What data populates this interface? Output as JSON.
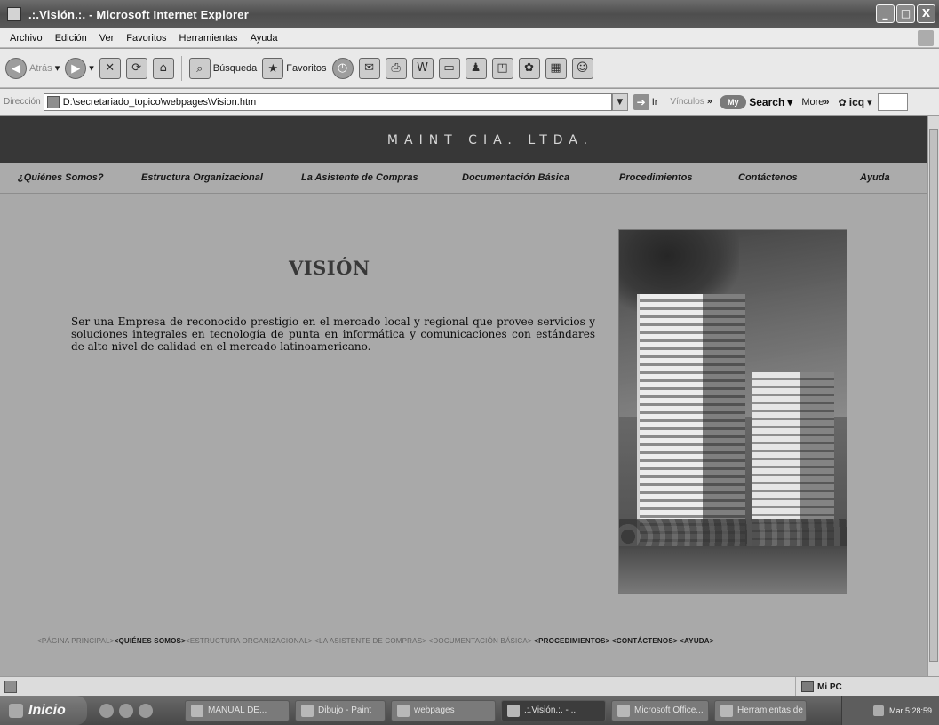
{
  "window": {
    "title": ".:.Visión.:. - Microsoft Internet Explorer",
    "controls": {
      "minimize": "_",
      "maximize": "□",
      "close": "X"
    }
  },
  "menu": [
    "Archivo",
    "Edición",
    "Ver",
    "Favoritos",
    "Herramientas",
    "Ayuda"
  ],
  "toolbar": {
    "back_label": "Atrás",
    "search_label": "Búsqueda",
    "favorites_label": "Favoritos"
  },
  "address": {
    "label": "Dirección",
    "value": "D:\\secretariado_topico\\webpages\\Vision.htm",
    "go_label": "Ir",
    "links_label": "Vínculos",
    "search_brand": "Search",
    "search_badge": "My",
    "more_label": "More",
    "icq_label": "icq"
  },
  "site": {
    "header_title": "MAINT CIA. LTDA.",
    "nav": [
      {
        "label": "¿Quiénes Somos?"
      },
      {
        "label": "Estructura Organizacional"
      },
      {
        "label": "La Asistente de Compras"
      },
      {
        "label": "Documentación Básica"
      },
      {
        "label": "Procedimientos"
      },
      {
        "label": "Contáctenos"
      },
      {
        "label": "Ayuda"
      }
    ],
    "heading": "VISIÓN",
    "body_text": "Ser una Empresa de reconocido prestigio en el mercado local y regional que provee servicios y soluciones integrales en tecnología de punta en informática y comunicaciones con estándares de alto nivel de calidad en el mercado latinoamericano.",
    "footer": [
      {
        "label": "<PÁGINA PRINCIPAL>",
        "strong": false
      },
      {
        "label": "<QUIÉNES SOMOS>",
        "strong": true
      },
      {
        "label": "<ESTRUCTURA ORGANIZACIONAL>",
        "strong": false
      },
      {
        "label": "<LA ASISTENTE DE COMPRAS>",
        "strong": false
      },
      {
        "label": "<DOCUMENTACIÓN BÁSICA>",
        "strong": false
      },
      {
        "label": "<PROCEDIMIENTOS>",
        "strong": true
      },
      {
        "label": "<CONTÁCTENOS>",
        "strong": true
      },
      {
        "label": "<AYUDA>",
        "strong": true
      }
    ]
  },
  "statusbar": {
    "zone_label": "Mi PC"
  },
  "taskbar": {
    "start_label": "Inicio",
    "tasks": [
      {
        "label": "MANUAL DE..."
      },
      {
        "label": "Dibujo - Paint"
      },
      {
        "label": "webpages"
      },
      {
        "label": ".:.Visión.:. - ...",
        "active": true
      },
      {
        "label": "Microsoft Office..."
      },
      {
        "label": "Herramientas de P..."
      }
    ],
    "clock": "Mar 5:28:59"
  }
}
